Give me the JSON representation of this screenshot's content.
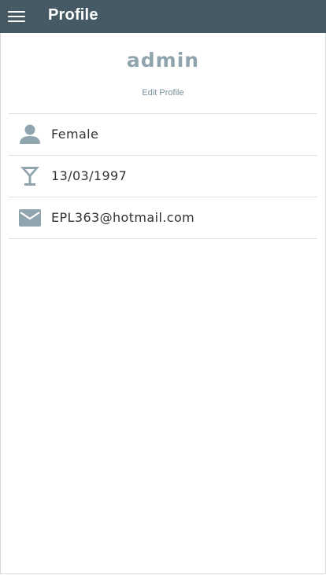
{
  "appbar": {
    "title": "Profile",
    "menu_icon": "hamburger-menu-icon",
    "background": "#455a64"
  },
  "profile": {
    "username": "admin",
    "edit_link": "Edit Profile",
    "accent": "#90a4ae"
  },
  "details": [
    {
      "icon": "person-icon",
      "value": "Female"
    },
    {
      "icon": "cocktail-glass-icon",
      "value": "13/03/1997"
    },
    {
      "icon": "envelope-icon",
      "value": "EPL363@hotmail.com"
    }
  ]
}
